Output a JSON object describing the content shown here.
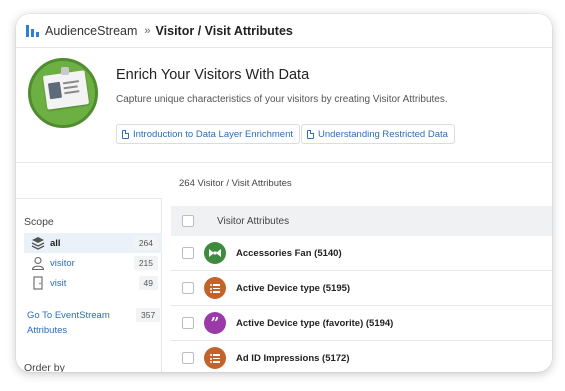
{
  "topbar": {
    "app_name": "AudienceStream",
    "separator": "»",
    "current_page": "Visitor / Visit Attributes"
  },
  "hero": {
    "title": "Enrich Your Visitors With Data",
    "subtitle": "Capture unique characteristics of your visitors by creating Visitor Attributes.",
    "links": [
      {
        "label": "Introduction to Data Layer Enrichment",
        "icon": "document-icon"
      },
      {
        "label": "Understanding Restricted Data",
        "icon": "document-icon"
      }
    ]
  },
  "attribute_count_text": "264 Visitor / Visit Attributes",
  "sidebar": {
    "scope_label": "Scope",
    "items": [
      {
        "label": "all",
        "count": "264",
        "icon": "layers-icon",
        "active": true
      },
      {
        "label": "visitor",
        "count": "215",
        "icon": "person-icon",
        "active": false
      },
      {
        "label": "visit",
        "count": "49",
        "icon": "door-icon",
        "active": false
      }
    ],
    "goto_label": "Go To EventStream Attributes",
    "goto_count": "357",
    "order_label": "Order by"
  },
  "list": {
    "header_label": "Visitor Attributes",
    "rows": [
      {
        "label": "Accessories Fan (5140)",
        "icon": "badge-icon",
        "color": "#3f8a3e"
      },
      {
        "label": "Active Device type (5195)",
        "icon": "list-icon",
        "color": "#c4622d"
      },
      {
        "label": "Active Device type (favorite) (5194)",
        "icon": "quote-icon",
        "color": "#9a3aa8"
      },
      {
        "label": "Ad ID Impressions (5172)",
        "icon": "list-icon",
        "color": "#c4622d"
      }
    ]
  },
  "colors": {
    "link": "#2a6fb8",
    "brand": "#2f7fd6",
    "hero_badge": "#6cb043"
  }
}
